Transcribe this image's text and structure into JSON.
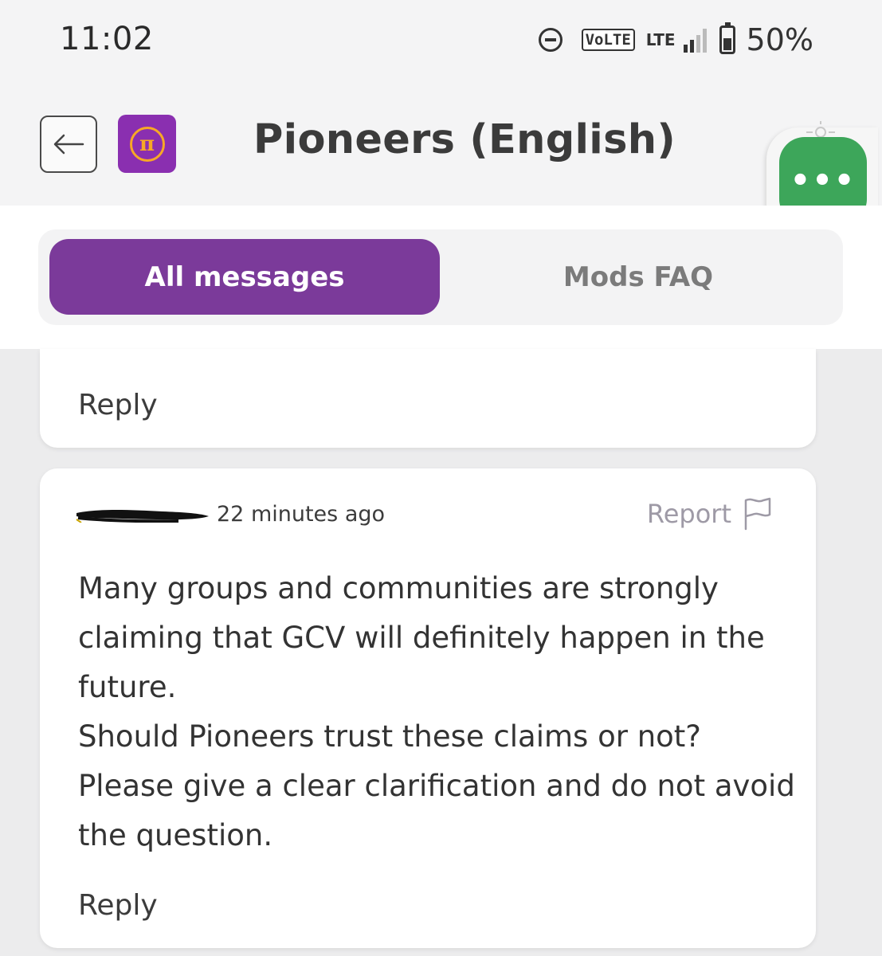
{
  "status_bar": {
    "time": "11:02",
    "volte": "VoLTE",
    "lte": "LTE",
    "battery": "50%"
  },
  "header": {
    "title": "Pioneers (English)",
    "logo_symbol": "π",
    "menu_glyph": "•••"
  },
  "tabs": [
    {
      "label": "All messages",
      "active": true
    },
    {
      "label": "Mods FAQ",
      "active": false
    }
  ],
  "messages": [
    {
      "reply_label": "Reply"
    },
    {
      "timestamp": "22 minutes ago",
      "report_label": "Report",
      "body_lines": [
        "Many groups and communities are strongly claiming that GCV will definitely happen in the future.",
        "Should Pioneers trust these claims or not? Please give a clear clarification and do not avoid the question."
      ],
      "reply_label": "Reply"
    }
  ],
  "colors": {
    "brand_purple": "#7b3a9a",
    "logo_purple": "#8a2fb0",
    "coin_gold": "#f7a826",
    "fab_green": "#3da65a"
  },
  "icons": {
    "back": "arrow-left-icon",
    "dnd": "do-not-disturb-icon",
    "signal": "signal-icon",
    "battery": "battery-icon",
    "report": "flag-icon",
    "menu": "more-dots-icon"
  }
}
